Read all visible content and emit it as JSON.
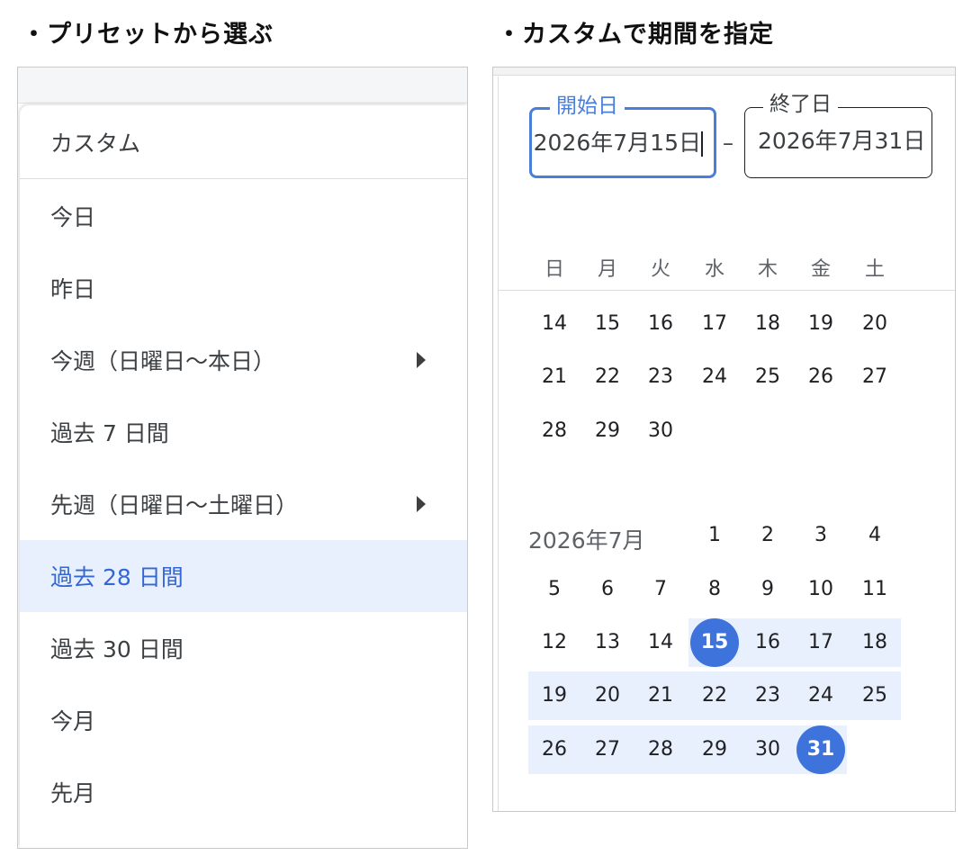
{
  "headings": {
    "preset": "・プリセットから選ぶ",
    "custom": "・カスタムで期間を指定"
  },
  "preset_menu": {
    "items": [
      {
        "label": "カスタム",
        "selected": false,
        "has_submenu": false
      },
      {
        "label": "今日",
        "selected": false,
        "has_submenu": false
      },
      {
        "label": "昨日",
        "selected": false,
        "has_submenu": false
      },
      {
        "label": "今週（日曜日〜本日）",
        "selected": false,
        "has_submenu": true
      },
      {
        "label": "過去 7 日間",
        "selected": false,
        "has_submenu": false
      },
      {
        "label": "先週（日曜日〜土曜日）",
        "selected": false,
        "has_submenu": true
      },
      {
        "label": "過去 28 日間",
        "selected": true,
        "has_submenu": false
      },
      {
        "label": "過去 30 日間",
        "selected": false,
        "has_submenu": false
      },
      {
        "label": "今月",
        "selected": false,
        "has_submenu": false
      },
      {
        "label": "先月",
        "selected": false,
        "has_submenu": false
      }
    ]
  },
  "date_range": {
    "start_label": "開始日",
    "start_value": "2026年7月15日",
    "separator": "–",
    "end_label": "終了日",
    "end_value": "2026年7月31日"
  },
  "calendar": {
    "weekdays": [
      "日",
      "月",
      "火",
      "水",
      "木",
      "金",
      "土"
    ],
    "prev_month_tail": [
      [
        14,
        15,
        16,
        17,
        18,
        19,
        20
      ],
      [
        21,
        22,
        23,
        24,
        25,
        26,
        27
      ],
      [
        28,
        29,
        30
      ]
    ],
    "month_label": "2026年7月",
    "month_weeks": [
      [
        null,
        null,
        null,
        1,
        2,
        3,
        4
      ],
      [
        5,
        6,
        7,
        8,
        9,
        10,
        11
      ],
      [
        12,
        13,
        14,
        15,
        16,
        17,
        18
      ],
      [
        19,
        20,
        21,
        22,
        23,
        24,
        25
      ],
      [
        26,
        27,
        28,
        29,
        30,
        31
      ]
    ],
    "range_start_day": 15,
    "range_end_day": 31
  },
  "colors": {
    "accent": "#3f73dc",
    "range_fill": "#e8f0fe",
    "selected_text": "#3367d6"
  }
}
